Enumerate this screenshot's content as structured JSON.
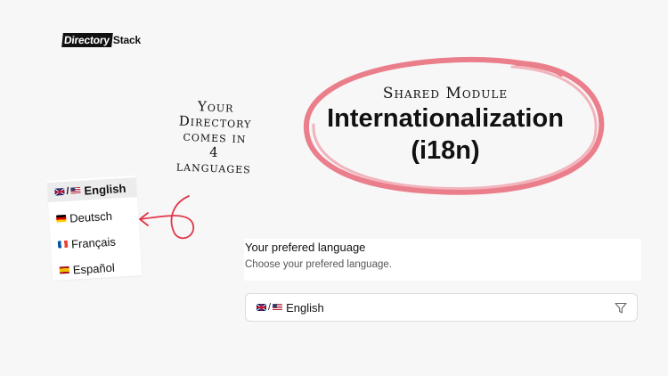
{
  "logo": {
    "part1": "Directory",
    "part2": "Stack"
  },
  "title": {
    "kicker": "Shared Module",
    "line1": "Internationalization",
    "line2": "(i18n)",
    "circle_color": "#e8707e"
  },
  "note": {
    "line1": "Your",
    "line2": "Directory",
    "line3": "comes in",
    "line4": "4",
    "line5": "languages"
  },
  "language_card": {
    "items": [
      {
        "label": "English",
        "flags": [
          "uk-flag-icon",
          "us-flag-icon"
        ],
        "active": true
      },
      {
        "label": "Deutsch",
        "flags": [
          "de-flag-icon"
        ],
        "active": false
      },
      {
        "label": "Français",
        "flags": [
          "fr-flag-icon"
        ],
        "active": false
      },
      {
        "label": "Español",
        "flags": [
          "es-flag-icon"
        ],
        "active": false
      }
    ],
    "slash": "/"
  },
  "form": {
    "label": "Your prefered language",
    "hint": "Choose your prefered language.",
    "select_value": "English",
    "select_slash": "/",
    "select_flags": [
      "uk-flag-icon",
      "us-flag-icon"
    ],
    "icon": "filter-icon"
  },
  "colors": {
    "accent_red": "#e0364a",
    "background": "#f7f7f7"
  }
}
